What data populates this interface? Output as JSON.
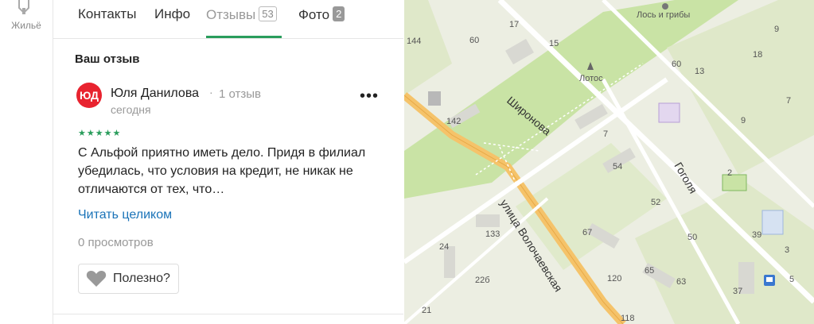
{
  "rail": {
    "label": "Жильё",
    "icon": "building-icon"
  },
  "tabs": [
    {
      "label": "Контакты"
    },
    {
      "label": "Инфо"
    },
    {
      "label": "Отзывы",
      "count": "53"
    },
    {
      "label": "Фото",
      "count": "2"
    }
  ],
  "section_title": "Ваш отзыв",
  "review": {
    "avatar_text": "ЮД",
    "author": "Юля Данилова",
    "separator": "·",
    "author_reviews": "1 отзыв",
    "date": "сегодня",
    "rating": "★★★★★",
    "text": "С Альфой приятно иметь дело. Придя в филиал убедилась, что условия на кредит, не никак не отличаются от тех, что…",
    "read_more": "Читать целиком",
    "views": "0 просмотров",
    "useful_label": "Полезно?",
    "more_label": "•••"
  },
  "map": {
    "pois": [
      "Лось и грибы",
      "Лотос"
    ],
    "streets": [
      "Широнова",
      "Гоголя",
      "улица Волочаевская"
    ],
    "house_numbers": [
      "144",
      "60",
      "17",
      "15",
      "142",
      "13",
      "60",
      "9",
      "18",
      "7",
      "54",
      "52",
      "50",
      "2",
      "39",
      "37",
      "133",
      "24",
      "22б",
      "67",
      "120",
      "65",
      "63",
      "21",
      "118",
      "5",
      "3",
      "9",
      "7"
    ]
  },
  "colors": {
    "accent": "#2a9d5c",
    "link": "#1a73b8",
    "avatar_bg": "#e8232f",
    "road": "#f5c36a"
  }
}
